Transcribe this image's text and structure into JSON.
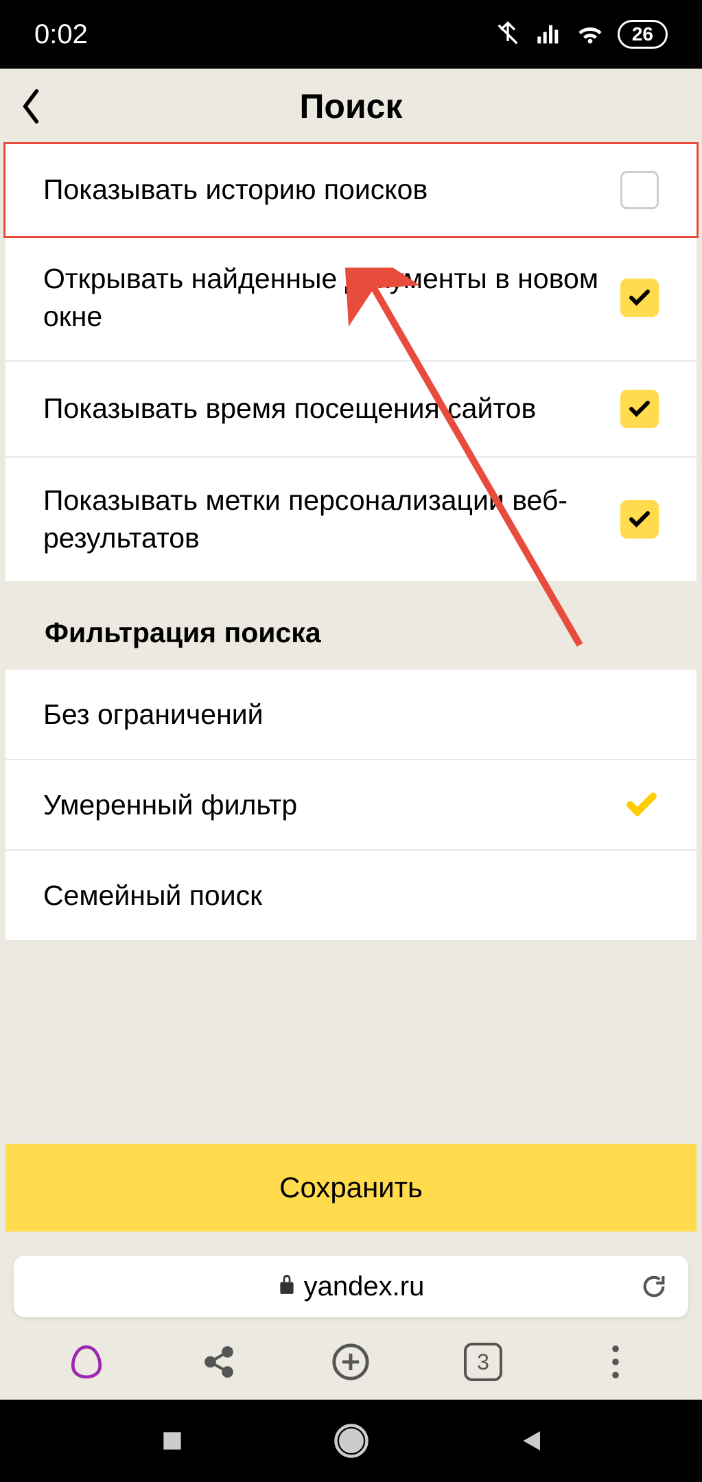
{
  "status": {
    "time": "0:02",
    "battery": "26"
  },
  "header": {
    "title": "Поиск"
  },
  "settings": [
    {
      "label": "Показывать историю поисков",
      "checked": false,
      "highlighted": true
    },
    {
      "label": "Открывать найденные документы в новом окне",
      "checked": true,
      "highlighted": false
    },
    {
      "label": "Показывать время посещения сайтов",
      "checked": true,
      "highlighted": false
    },
    {
      "label": "Показывать метки персонализации веб-результатов",
      "checked": true,
      "highlighted": false
    }
  ],
  "filter": {
    "section_title": "Фильтрация поиска",
    "options": [
      {
        "label": "Без ограничений",
        "selected": false
      },
      {
        "label": "Умеренный фильтр",
        "selected": true
      },
      {
        "label": "Семейный поиск",
        "selected": false
      }
    ]
  },
  "save_button": "Сохранить",
  "url": "yandex.ru",
  "tab_count": "3"
}
